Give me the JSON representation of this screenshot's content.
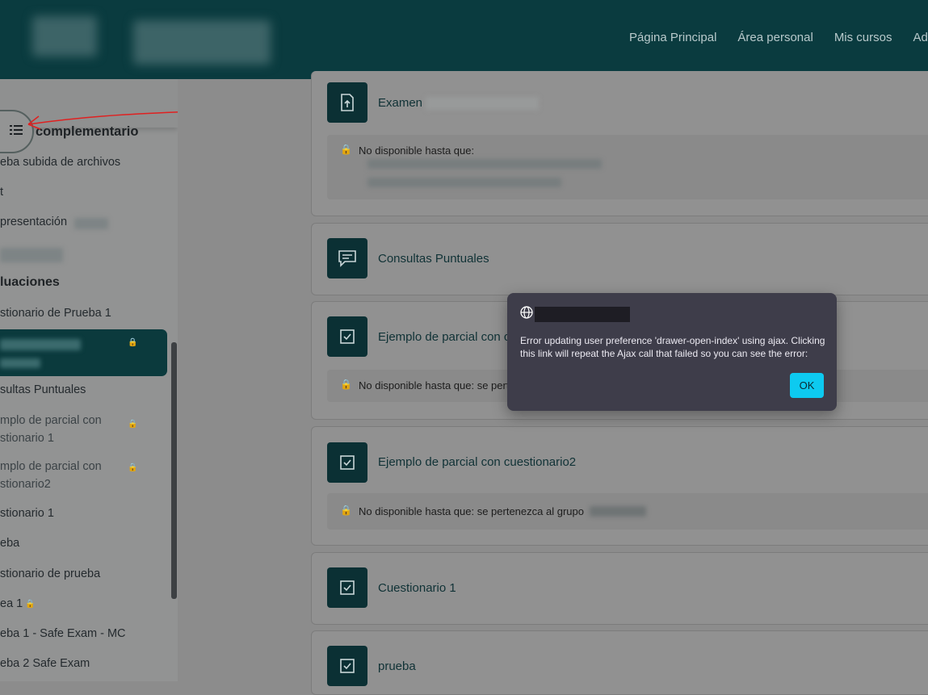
{
  "navbar": {
    "links": [
      "Página Principal",
      "Área personal",
      "Mis cursos",
      "Adr"
    ]
  },
  "drawer": {
    "title": "complementario",
    "items": {
      "file_upload": "eba subida de archivos",
      "item_t": "t",
      "presentation": "presentación",
      "section_evaluaciones": "luaciones",
      "quiz_test1": "stionario de Prueba 1",
      "consultas": "sultas Puntuales",
      "parcial1_line1": "mplo de parcial con",
      "parcial1_line2": "stionario 1",
      "parcial2_line1": "mplo de parcial con",
      "parcial2_line2": "stionario2",
      "cuestionario1": "stionario 1",
      "prueba": "eba",
      "cuestionario_prueba": "stionario de prueba",
      "prueba1": "ea 1",
      "prueba1_safe": "eba 1 - Safe Exam - MC",
      "prueba2_safe": "eba 2 Safe Exam"
    }
  },
  "main": {
    "activities": [
      {
        "title": "Examen",
        "icon": "file-upload-icon",
        "restriction": "No disponible hasta que:"
      },
      {
        "title": "Consultas Puntuales",
        "icon": "forum-icon"
      },
      {
        "title": "Ejemplo de parcial con c",
        "icon": "quiz-icon",
        "restriction": "No disponible hasta que: se perten"
      },
      {
        "title": "Ejemplo de parcial con cuestionario2",
        "icon": "quiz-icon",
        "restriction": "No disponible hasta que: se pertenezca al grupo"
      },
      {
        "title": "Cuestionario 1",
        "icon": "quiz-icon"
      },
      {
        "title": "prueba",
        "icon": "quiz-icon"
      }
    ]
  },
  "modal": {
    "message": "Error updating user preference 'drawer-open-index' using ajax. Clicking this link will repeat the Ajax call that failed so you can see the error:",
    "ok_label": "OK"
  },
  "colors": {
    "navbar": "#0a3b3f",
    "accent": "#0dcaf0",
    "annotation_arrow": "#e02020"
  }
}
